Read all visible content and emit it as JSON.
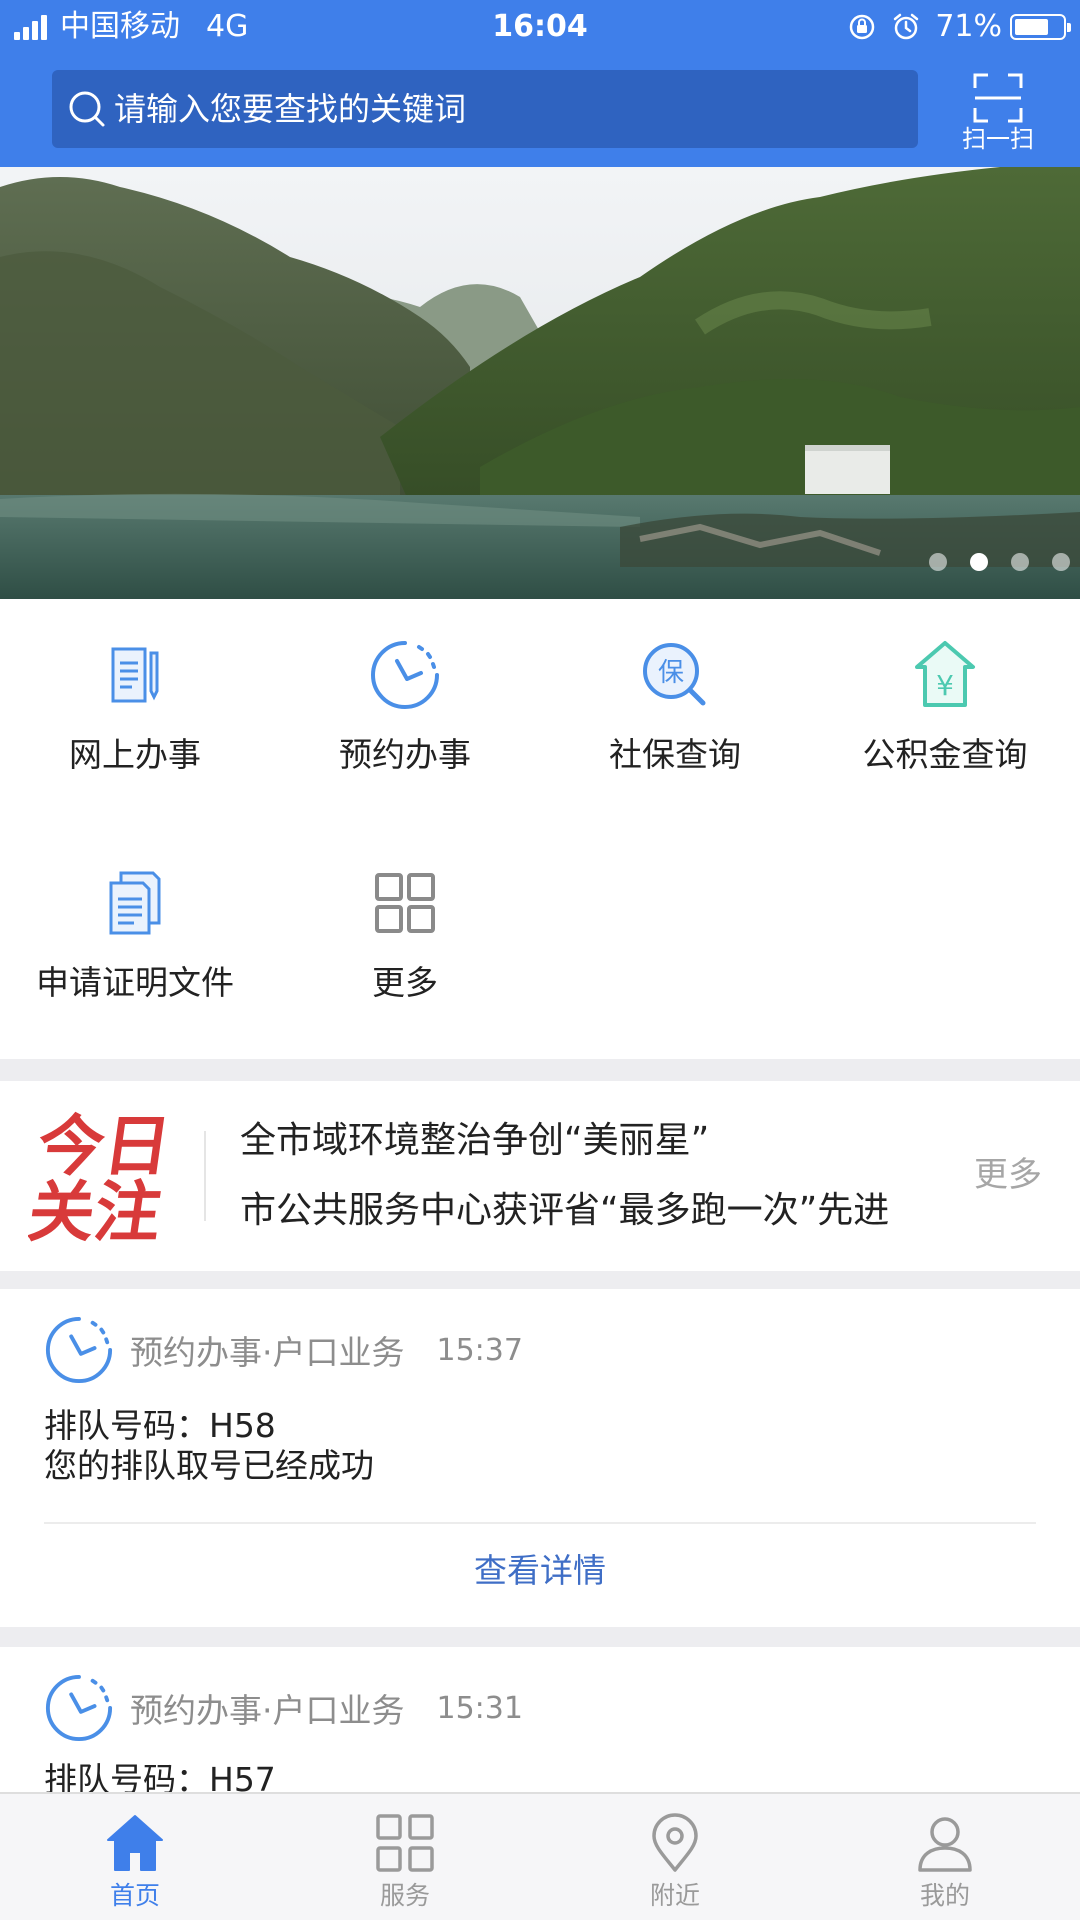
{
  "status_bar": {
    "carrier": "中国移动",
    "network": "4G",
    "time": "16:04",
    "battery_percent": "71%",
    "battery_level": 0.71,
    "icons": [
      "signal-icon",
      "orientation-lock-icon",
      "alarm-icon",
      "battery-icon"
    ]
  },
  "search": {
    "placeholder": "请输入您要查找的关键词",
    "scan_label": "扫一扫"
  },
  "banner": {
    "slide_count": 4,
    "active_slide": 2
  },
  "services": [
    {
      "label": "网上办事",
      "icon": "online-service-icon",
      "color": "#4a8fe7"
    },
    {
      "label": "预约办事",
      "icon": "appointment-clock-icon",
      "color": "#4a8fe7"
    },
    {
      "label": "社保查询",
      "icon": "social-security-search-icon",
      "icon_text": "保",
      "color": "#4a8fe7"
    },
    {
      "label": "公积金查询",
      "icon": "housing-fund-icon",
      "icon_text": "¥",
      "color": "#4cc9b0"
    },
    {
      "label": "申请证明文件",
      "icon": "documents-icon",
      "color": "#4a8fe7"
    },
    {
      "label": "更多",
      "icon": "grid-more-icon",
      "color": "#8a8a8a"
    }
  ],
  "focus": {
    "logo_line1": "今日",
    "logo_line2": "关注",
    "items": [
      "全市域环境整治争创“美丽星”",
      "市公共服务中心获评省“最多跑一次”先进"
    ],
    "more_label": "更多"
  },
  "cards": [
    {
      "category": "预约办事·户口业务",
      "time": "15:37",
      "queue_line": "排队号码：H58",
      "message": "您的排队取号已经成功",
      "link_label": "查看详情"
    },
    {
      "category": "预约办事·户口业务",
      "time": "15:31",
      "queue_line": "排队号码：H57"
    }
  ],
  "tabbar": [
    {
      "label": "首页",
      "icon": "home-icon",
      "active": true
    },
    {
      "label": "服务",
      "icon": "grid-icon",
      "active": false
    },
    {
      "label": "附近",
      "icon": "location-pin-icon",
      "active": false
    },
    {
      "label": "我的",
      "icon": "user-icon",
      "active": false
    }
  ],
  "colors": {
    "primary": "#3f7fea",
    "search_bg": "#2f63c0",
    "link": "#3f6ec6",
    "muted": "#8d8d8d",
    "focus_red": "#d83a3a"
  }
}
